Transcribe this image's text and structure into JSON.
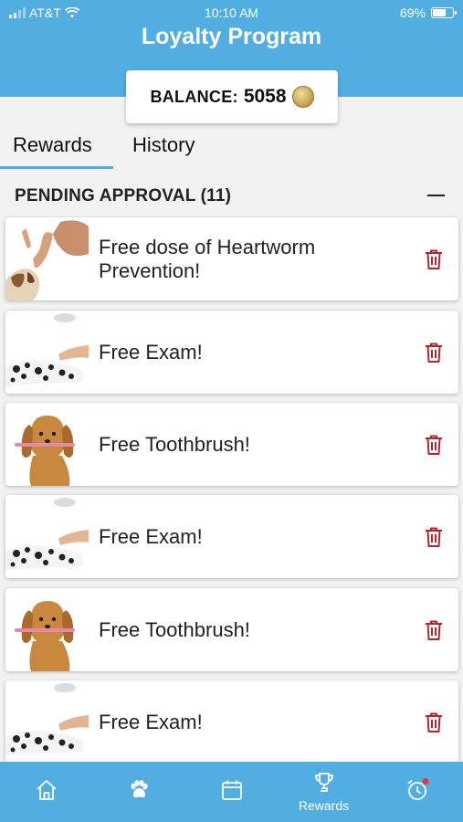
{
  "status_bar": {
    "carrier": "AT&T",
    "time": "10:10 AM",
    "battery": "69%"
  },
  "header": {
    "title": "Loyalty Program"
  },
  "balance": {
    "label": "BALANCE:",
    "value": "5058",
    "icon": "coin-icon"
  },
  "tabs": [
    {
      "label": "Rewards",
      "active": true
    },
    {
      "label": "History",
      "active": false
    }
  ],
  "section": {
    "title": "PENDING APPROVAL (11)",
    "icon": "collapse-icon"
  },
  "rewards": [
    {
      "title": "Free dose of Heartworm Prevention!",
      "image": "dog-high-five"
    },
    {
      "title": "Free Exam!",
      "image": "dalmatian-exam"
    },
    {
      "title": "Free Toothbrush!",
      "image": "dachshund-toothbrush"
    },
    {
      "title": "Free Exam!",
      "image": "dalmatian-exam"
    },
    {
      "title": "Free Toothbrush!",
      "image": "dachshund-toothbrush"
    },
    {
      "title": "Free Exam!",
      "image": "dalmatian-exam"
    }
  ],
  "bottom_nav": [
    {
      "icon": "home-icon",
      "label": ""
    },
    {
      "icon": "paw-icon",
      "label": ""
    },
    {
      "icon": "calendar-icon",
      "label": ""
    },
    {
      "icon": "trophy-icon",
      "label": "Rewards",
      "active": true
    },
    {
      "icon": "alarm-icon",
      "label": "",
      "badge": true
    }
  ],
  "colors": {
    "primary": "#52aee1",
    "trash": "#b3242f",
    "badge": "#e8344a"
  }
}
